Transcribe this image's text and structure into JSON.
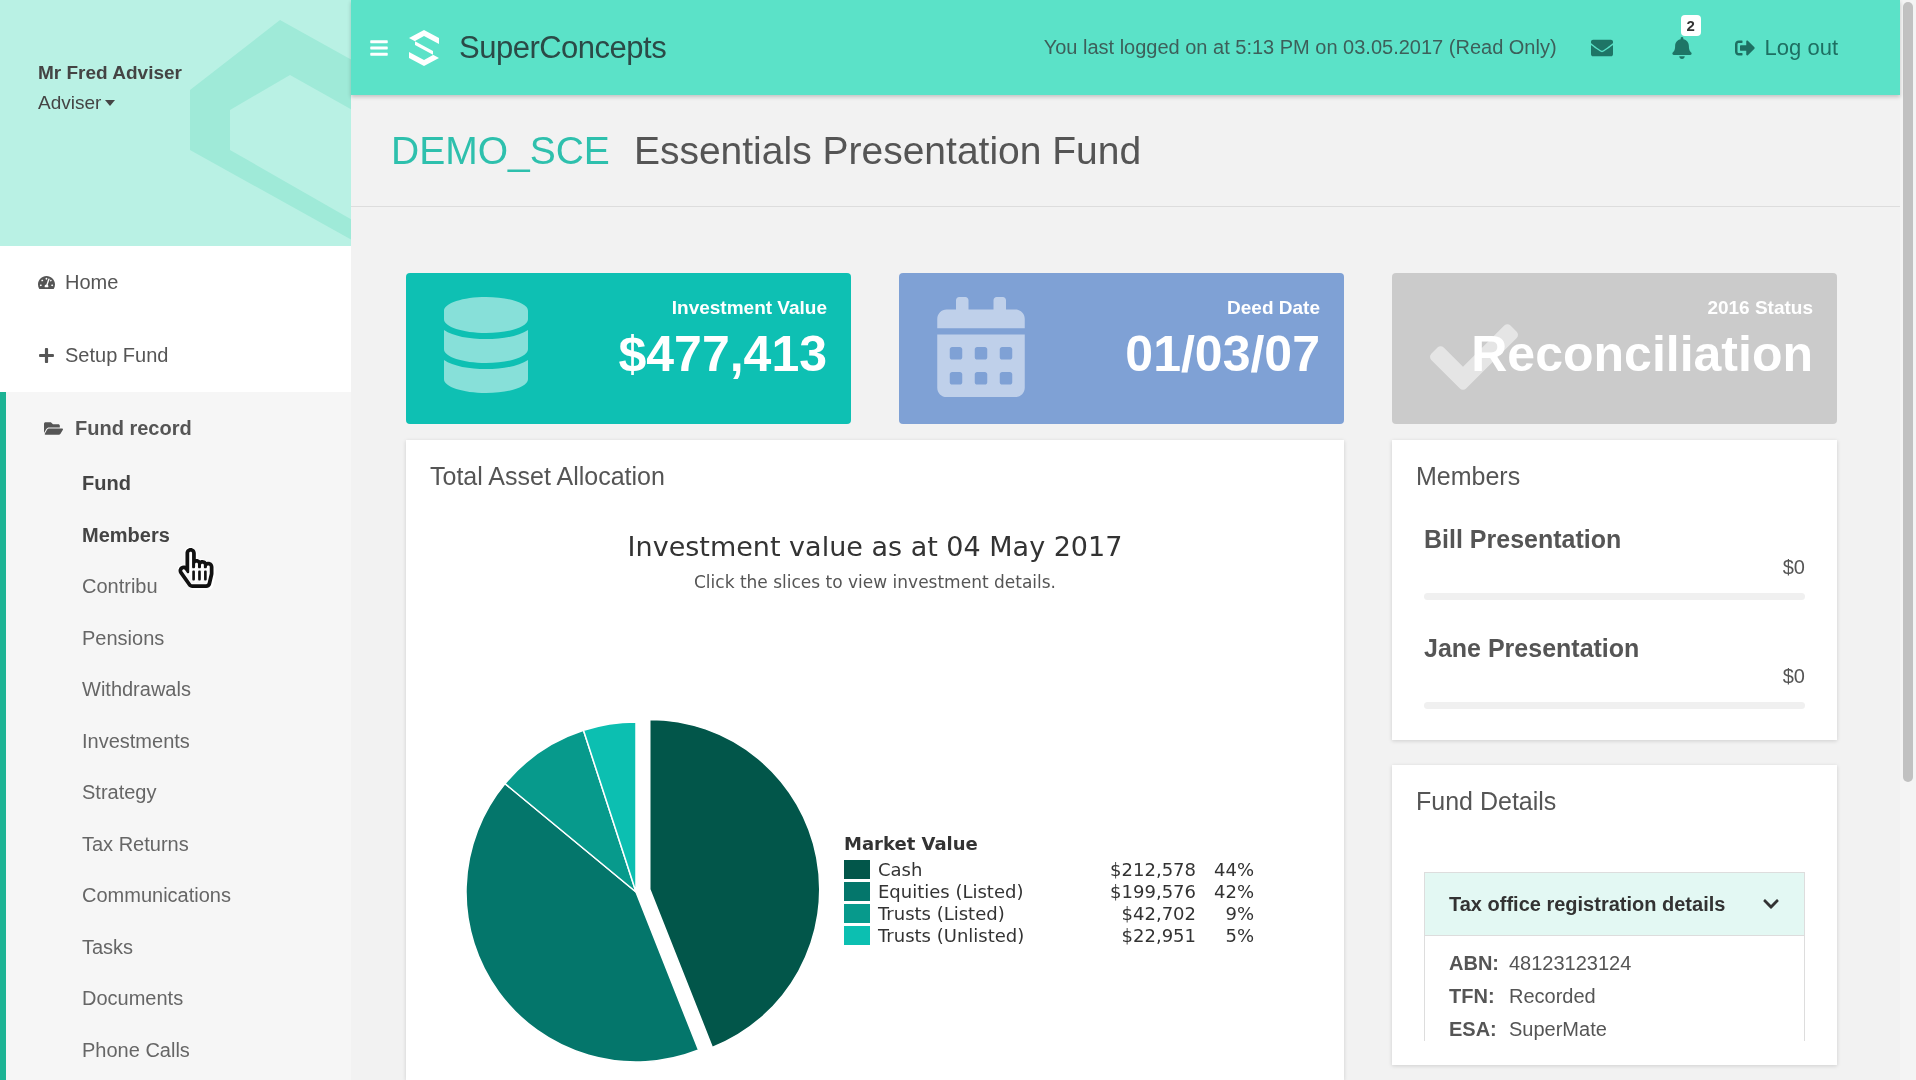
{
  "sidebar": {
    "user_name": "Mr Fred Adviser",
    "role": "Adviser",
    "items": [
      {
        "kind": "home",
        "label": "Home"
      },
      {
        "kind": "add",
        "label": "Setup Fund"
      }
    ],
    "section": {
      "label": "Fund record",
      "expanded": true,
      "children": [
        {
          "label": "Fund",
          "selected": true
        },
        {
          "label": "Members",
          "selected": true
        },
        {
          "label": "Contribu",
          "selected": false
        },
        {
          "label": "Pensions",
          "selected": false
        },
        {
          "label": "Withdrawals",
          "selected": false
        },
        {
          "label": "Investments",
          "selected": false
        },
        {
          "label": "Strategy",
          "selected": false
        },
        {
          "label": "Tax Returns",
          "selected": false
        },
        {
          "label": "Communications",
          "selected": false
        },
        {
          "label": "Tasks",
          "selected": false
        },
        {
          "label": "Documents",
          "selected": false
        },
        {
          "label": "Phone Calls",
          "selected": false
        }
      ]
    }
  },
  "header": {
    "brand": "SuperConcepts",
    "last_login": "You last logged on at 5:13 PM on 03.05.2017 (Read Only)",
    "notification_count": "2",
    "logout": "Log out"
  },
  "page_title": {
    "code": "DEMO_SCE",
    "name": "Essentials Presentation Fund"
  },
  "stat_cards": [
    {
      "kind": "value",
      "label": "Investment Value",
      "value": "$477,413"
    },
    {
      "kind": "date",
      "label": "Deed Date",
      "value": "01/03/07"
    },
    {
      "kind": "status",
      "label": "2016 Status",
      "value": "Reconciliation"
    }
  ],
  "allocation": {
    "heading": "Total Asset Allocation",
    "subtitle": "Click the slices to view investment details.",
    "legend_title": "Market Value",
    "legend": [
      {
        "value": "$212,578",
        "percent": "44%",
        "color": "#02564a"
      },
      {
        "value": "$199,576",
        "percent": "42%",
        "color": "#04766b"
      },
      {
        "value": "$42,702",
        "percent": "9%",
        "color": "#079a8c"
      },
      {
        "value": "$22,951",
        "percent": "5%",
        "color": "#0cbfb1"
      }
    ],
    "chart_data": {
      "type": "pie",
      "title": "Investment value as at 04 May 2017",
      "categories": [
        "Cash",
        "Equities (Listed)",
        "Trusts (Listed)",
        "Trusts (Unlisted)"
      ],
      "values": [
        44,
        42,
        9,
        5
      ]
    }
  },
  "members": {
    "heading": "Members",
    "items": [
      {
        "name": "Bill Presentation",
        "balance": "$0",
        "level": 0
      },
      {
        "name": "Jane Presentation",
        "balance": "$0",
        "level": 0
      }
    ]
  },
  "fund_details": {
    "heading": "Fund Details",
    "panel": {
      "title": "Tax office registration details",
      "expanded": true,
      "rows": [
        {
          "label": "ABN:",
          "value": "48123123124"
        },
        {
          "label": "TFN:",
          "value": "Recorded"
        },
        {
          "label": "ESA:",
          "value": "SuperMate"
        }
      ]
    }
  }
}
